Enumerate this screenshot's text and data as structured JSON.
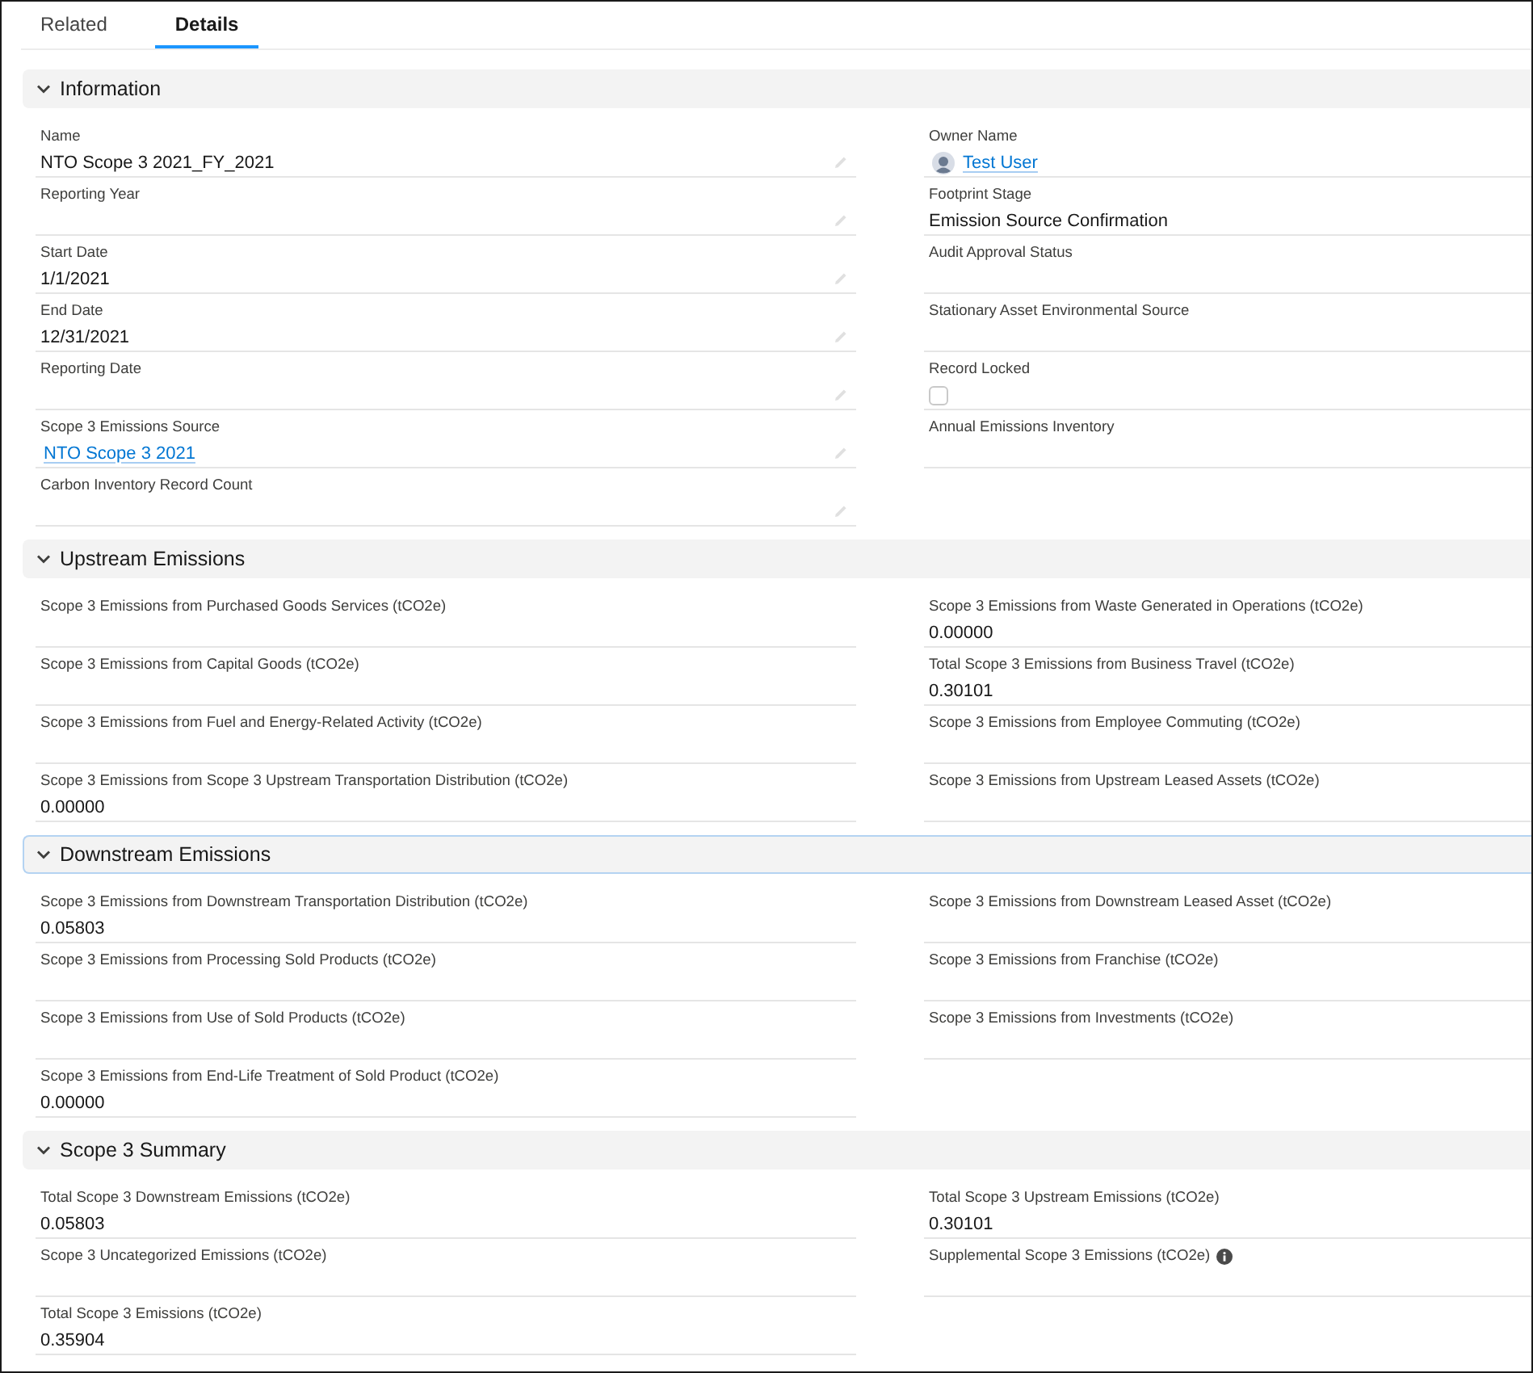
{
  "tabs": [
    {
      "label": "Related",
      "selected": false
    },
    {
      "label": "Details",
      "selected": true
    }
  ],
  "sections": [
    {
      "title": "Information",
      "expanded": true,
      "focused": false,
      "fields": [
        {
          "kind": "text",
          "label": "Name",
          "value": "NTO Scope 3 2021_FY_2021",
          "editable": true,
          "help": false
        },
        {
          "kind": "user",
          "label": "Owner Name",
          "value": "Test User",
          "editable": false,
          "help": false
        },
        {
          "kind": "text",
          "label": "Reporting Year",
          "editable": true,
          "help": false
        },
        {
          "kind": "text",
          "label": "Footprint Stage",
          "value": "Emission Source Confirmation",
          "editable": false,
          "help": false
        },
        {
          "kind": "text",
          "label": "Start Date",
          "value": "1/1/2021",
          "editable": true,
          "help": false
        },
        {
          "kind": "text",
          "label": "Audit Approval Status",
          "editable": false,
          "help": false
        },
        {
          "kind": "text",
          "label": "End Date",
          "value": "12/31/2021",
          "editable": true,
          "help": false
        },
        {
          "kind": "text",
          "label": "Stationary Asset Environmental Source",
          "editable": false,
          "help": false
        },
        {
          "kind": "text",
          "label": "Reporting Date",
          "editable": true,
          "help": false
        },
        {
          "kind": "checkbox",
          "label": "Record Locked",
          "checked": false,
          "editable": false,
          "help": false
        },
        {
          "kind": "link",
          "label": "Scope 3 Emissions Source",
          "value": "NTO Scope 3 2021",
          "editable": true,
          "help": false
        },
        {
          "kind": "text",
          "label": "Annual Emissions Inventory",
          "editable": false,
          "help": false
        },
        {
          "kind": "text",
          "label": "Carbon Inventory Record Count",
          "editable": true,
          "help": false
        }
      ]
    },
    {
      "title": "Upstream Emissions",
      "expanded": true,
      "focused": false,
      "fields": [
        {
          "kind": "text",
          "label": "Scope 3 Emissions from Purchased Goods Services (tCO2e)",
          "editable": false,
          "help": false
        },
        {
          "kind": "text",
          "label": "Scope 3 Emissions from Waste Generated in Operations (tCO2e)",
          "value": "0.00000",
          "editable": false,
          "help": false
        },
        {
          "kind": "text",
          "label": "Scope 3 Emissions from Capital Goods (tCO2e)",
          "editable": false,
          "help": false
        },
        {
          "kind": "text",
          "label": "Total Scope 3 Emissions from Business Travel (tCO2e)",
          "value": "0.30101",
          "editable": false,
          "help": false
        },
        {
          "kind": "text",
          "label": "Scope 3 Emissions from Fuel and Energy-Related Activity (tCO2e)",
          "editable": false,
          "help": false
        },
        {
          "kind": "text",
          "label": "Scope 3 Emissions from Employee Commuting (tCO2e)",
          "editable": false,
          "help": false
        },
        {
          "kind": "text",
          "label": "Scope 3 Emissions from Scope 3 Upstream Transportation Distribution (tCO2e)",
          "value": "0.00000",
          "editable": false,
          "help": false
        },
        {
          "kind": "text",
          "label": "Scope 3 Emissions from Upstream Leased Assets (tCO2e)",
          "editable": false,
          "help": false
        }
      ]
    },
    {
      "title": "Downstream Emissions",
      "expanded": true,
      "focused": true,
      "fields": [
        {
          "kind": "text",
          "label": "Scope 3 Emissions from Downstream Transportation Distribution (tCO2e)",
          "value": "0.05803",
          "editable": false,
          "help": false
        },
        {
          "kind": "text",
          "label": "Scope 3 Emissions from Downstream Leased Asset (tCO2e)",
          "editable": false,
          "help": false
        },
        {
          "kind": "text",
          "label": "Scope 3 Emissions from Processing Sold Products (tCO2e)",
          "editable": false,
          "help": false
        },
        {
          "kind": "text",
          "label": "Scope 3 Emissions from Franchise (tCO2e)",
          "editable": false,
          "help": false
        },
        {
          "kind": "text",
          "label": "Scope 3 Emissions from Use of Sold Products (tCO2e)",
          "editable": false,
          "help": false
        },
        {
          "kind": "text",
          "label": "Scope 3 Emissions from Investments (tCO2e)",
          "editable": false,
          "help": false
        },
        {
          "kind": "text",
          "label": "Scope 3 Emissions from End-Life Treatment of Sold Product (tCO2e)",
          "value": "0.00000",
          "editable": false,
          "help": false
        }
      ]
    },
    {
      "title": "Scope 3 Summary",
      "expanded": true,
      "focused": false,
      "fields": [
        {
          "kind": "text",
          "label": "Total Scope 3 Downstream Emissions (tCO2e)",
          "value": "0.05803",
          "editable": false,
          "help": false
        },
        {
          "kind": "text",
          "label": "Total Scope 3 Upstream Emissions (tCO2e)",
          "value": "0.30101",
          "editable": false,
          "help": false
        },
        {
          "kind": "text",
          "label": "Scope 3 Uncategorized Emissions (tCO2e)",
          "editable": false,
          "help": false
        },
        {
          "kind": "text",
          "label": "Supplemental Scope 3 Emissions (tCO2e)",
          "editable": false,
          "help": true
        },
        {
          "kind": "text",
          "label": "Total Scope 3 Emissions (tCO2e)",
          "value": "0.35904",
          "editable": false,
          "help": false
        }
      ]
    }
  ]
}
